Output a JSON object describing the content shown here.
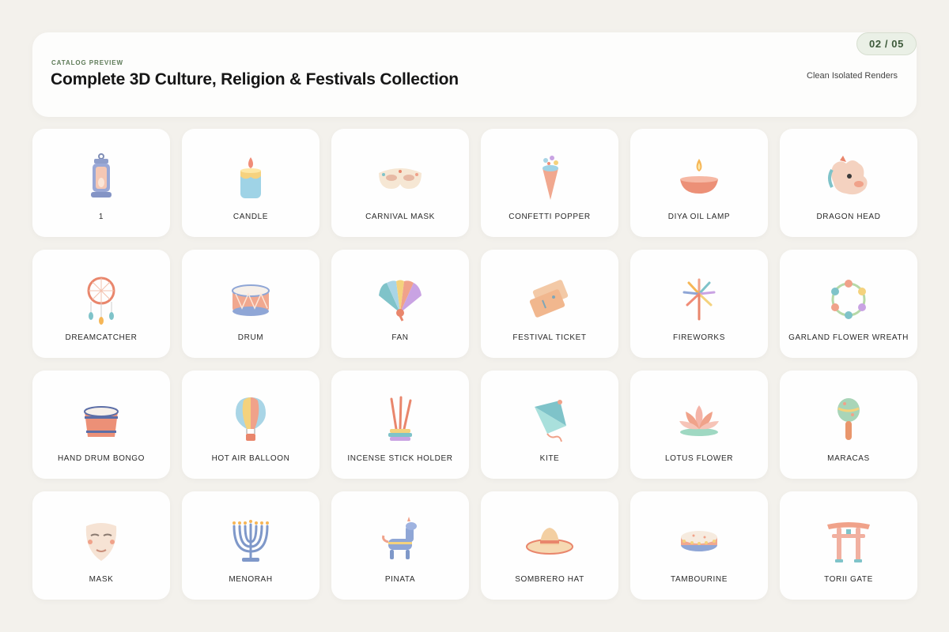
{
  "header": {
    "eyebrow": "CATALOG PREVIEW",
    "title": "Complete 3D Culture, Religion & Festivals Collection",
    "pager": "02 / 05",
    "subtitle": "Clean Isolated Renders"
  },
  "items": [
    {
      "label": "1",
      "icon": "lantern-icon"
    },
    {
      "label": "CANDLE",
      "icon": "candle-icon"
    },
    {
      "label": "CARNIVAL MASK",
      "icon": "carnival-mask-icon"
    },
    {
      "label": "CONFETTI POPPER",
      "icon": "confetti-popper-icon"
    },
    {
      "label": "DIYA OIL LAMP",
      "icon": "diya-oil-lamp-icon"
    },
    {
      "label": "DRAGON HEAD",
      "icon": "dragon-head-icon"
    },
    {
      "label": "DREAMCATCHER",
      "icon": "dreamcatcher-icon"
    },
    {
      "label": "DRUM",
      "icon": "drum-icon"
    },
    {
      "label": "FAN",
      "icon": "fan-icon"
    },
    {
      "label": "FESTIVAL TICKET",
      "icon": "festival-ticket-icon"
    },
    {
      "label": "FIREWORKS",
      "icon": "fireworks-icon"
    },
    {
      "label": "GARLAND FLOWER WREATH",
      "icon": "garland-flower-wreath-icon"
    },
    {
      "label": "HAND DRUM BONGO",
      "icon": "hand-drum-bongo-icon"
    },
    {
      "label": "HOT AIR BALLOON",
      "icon": "hot-air-balloon-icon"
    },
    {
      "label": "INCENSE STICK HOLDER",
      "icon": "incense-stick-holder-icon"
    },
    {
      "label": "KITE",
      "icon": "kite-icon"
    },
    {
      "label": "LOTUS FLOWER",
      "icon": "lotus-flower-icon"
    },
    {
      "label": "MARACAS",
      "icon": "maracas-icon"
    },
    {
      "label": "MASK",
      "icon": "mask-icon"
    },
    {
      "label": "MENORAH",
      "icon": "menorah-icon"
    },
    {
      "label": "PINATA",
      "icon": "pinata-icon"
    },
    {
      "label": "SOMBRERO HAT",
      "icon": "sombrero-hat-icon"
    },
    {
      "label": "TAMBOURINE",
      "icon": "tambourine-icon"
    },
    {
      "label": "TORII GATE",
      "icon": "torii-gate-icon"
    }
  ],
  "colors": {
    "background": "#f3f1ec",
    "card": "#fefefe",
    "accent_green": "#5d7a57",
    "pager_bg": "#eaf0e6"
  }
}
